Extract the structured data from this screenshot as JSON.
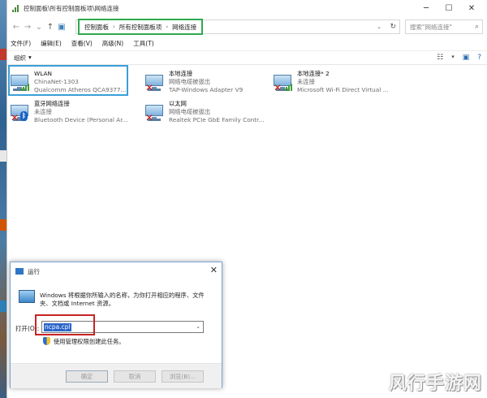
{
  "window": {
    "title": "控制面板\\所有控制面板项\\网络连接",
    "min_glyph": "─",
    "max_glyph": "☐",
    "close_glyph": "✕"
  },
  "address": {
    "crumbs": [
      "控制面板",
      "所有控制面板项",
      "网络连接"
    ],
    "search_placeholder": "搜索\"网络连接\""
  },
  "menu": [
    "文件(F)",
    "编辑(E)",
    "查看(V)",
    "高级(N)",
    "工具(T)"
  ],
  "command": {
    "organize": "组织",
    "organize_arrow": "▾"
  },
  "connections": [
    {
      "name": "WLAN",
      "status": "ChinaNet-1303",
      "device": "Qualcomm Atheros QCA9377...",
      "icon": "wifi-icon"
    },
    {
      "name": "本地连接",
      "status": "网络电缆被拔出",
      "device": "TAP-Windows Adapter V9",
      "icon": "ethernet-disconnected-icon"
    },
    {
      "name": "本地连接* 2",
      "status": "未连接",
      "device": "Microsoft Wi-Fi Direct Virtual ...",
      "icon": "wifi-disconnected-icon"
    },
    {
      "name": "蓝牙网络连接",
      "status": "未连接",
      "device": "Bluetooth Device (Personal Ar...",
      "icon": "bluetooth-disconnected-icon"
    },
    {
      "name": "以太网",
      "status": "网络电缆被拔出",
      "device": "Realtek PCIe GbE Family Contr...",
      "icon": "ethernet-disconnected-icon"
    }
  ],
  "run_dialog": {
    "title": "运行",
    "description": "Windows 将根据你所输入的名称，为你打开相应的程序、文件夹、文档或 Internet 资源。",
    "open_label": "打开(O):",
    "input_value": "ncpa.cpl",
    "admin_text": "使用管理权限创建此任务。",
    "ok_label": "确定",
    "cancel_label": "取消",
    "browse_label": "浏览(B)..."
  },
  "watermark": "风行手游网"
}
